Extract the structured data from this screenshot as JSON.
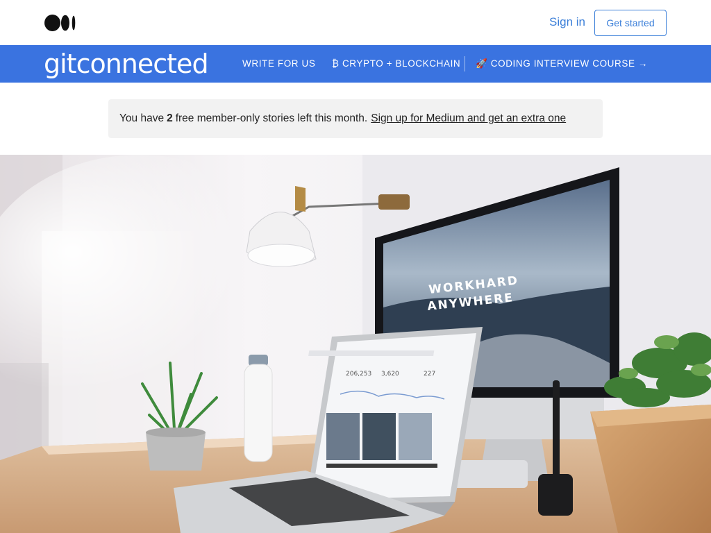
{
  "topbar": {
    "logo_icon": "medium-logo-icon",
    "sign_in_label": "Sign in",
    "get_started_label": "Get started"
  },
  "publication": {
    "name": "gitconnected",
    "nav": [
      {
        "label": "WRITE FOR US"
      },
      {
        "label": "₿ CRYPTO + BLOCKCHAIN"
      },
      {
        "label": "🚀 CODING INTERVIEW COURSE →"
      }
    ]
  },
  "banner": {
    "prefix": "You have",
    "count": "2",
    "suffix": "free member-only stories left this month.",
    "link_label": "Sign up for Medium and get an extra one"
  },
  "hero": {
    "monitor_text_line1": "WORKHARD",
    "monitor_text_line2": "ANYWHERE",
    "laptop_stats": [
      "206,253",
      "3,620",
      "227"
    ]
  },
  "colors": {
    "accent": "#3a73e0",
    "link": "#3b7fd9",
    "banner_bg": "#f2f2f2"
  }
}
